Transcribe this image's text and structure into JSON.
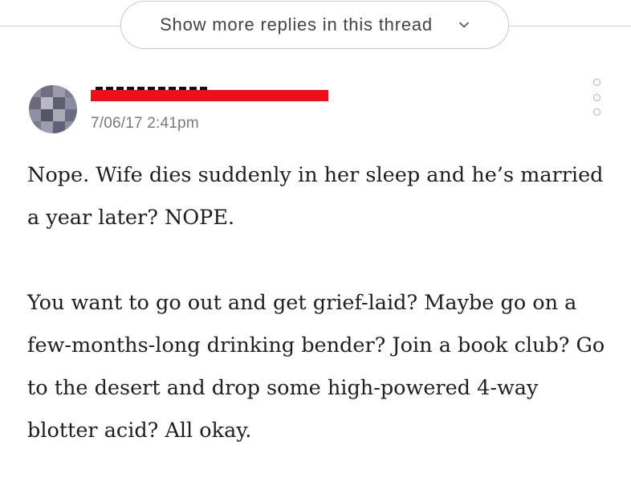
{
  "thread": {
    "show_more_label": "Show more replies in this thread",
    "chevron_icon": "chevron-down-icon"
  },
  "comment": {
    "timestamp": "7/06/17 2:41pm",
    "avatar_icon": "pixel-avatar",
    "redaction_color": "#f20d1a",
    "more_options_icon": "vertical-dots-icon",
    "paragraphs": [
      "Nope. Wife dies suddenly in her sleep and he’s married a year later? NOPE.",
      "You want to go out and get grief-laid? Maybe go on a few-months-long drinking bender? Join a book club? Go to the desert and drop some high-powered 4-way blotter acid? All okay."
    ]
  }
}
